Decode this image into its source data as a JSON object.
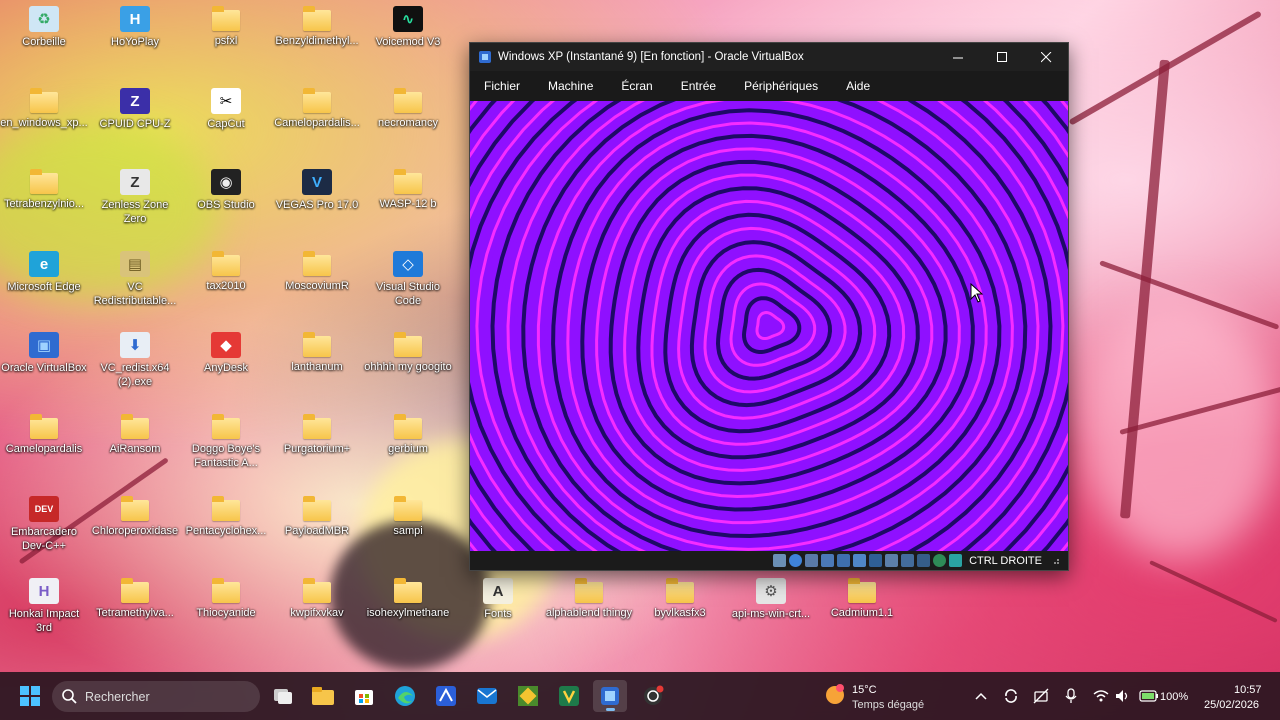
{
  "desktop": {
    "icons": [
      {
        "label": "Corbeille",
        "kind": "recycle-bin-icon"
      },
      {
        "label": "HoYoPlay",
        "kind": "hoyoplay-icon"
      },
      {
        "label": "psfxl",
        "kind": "folder-icon"
      },
      {
        "label": "Benzyldimethyl...",
        "kind": "folder-icon"
      },
      {
        "label": "Voicemod V3",
        "kind": "voicemod-icon"
      },
      {
        "label": "en_windows_xp...",
        "kind": "folder-icon"
      },
      {
        "label": "CPUID CPU-Z",
        "kind": "cpuz-icon"
      },
      {
        "label": "CapCut",
        "kind": "capcut-icon"
      },
      {
        "label": "Camelopardalis...",
        "kind": "folder-icon"
      },
      {
        "label": "necromancy",
        "kind": "folder-icon"
      },
      {
        "label": "Tetrabenzylnio...",
        "kind": "folder-icon"
      },
      {
        "label": "Zenless Zone Zero",
        "kind": "zenless-icon"
      },
      {
        "label": "OBS Studio",
        "kind": "obs-icon"
      },
      {
        "label": "VEGAS Pro 17.0",
        "kind": "vegas-icon"
      },
      {
        "label": "WASP-12 b",
        "kind": "folder-icon"
      },
      {
        "label": "Microsoft Edge",
        "kind": "edge-icon"
      },
      {
        "label": "VC Redistributable...",
        "kind": "archive-icon"
      },
      {
        "label": "tax2010",
        "kind": "folder-icon"
      },
      {
        "label": "MoscoviumR",
        "kind": "folder-icon"
      },
      {
        "label": "Visual Studio Code",
        "kind": "vscode-icon"
      },
      {
        "label": "Oracle VirtualBox",
        "kind": "virtualbox-icon"
      },
      {
        "label": "VC_redist.x64 (2).exe",
        "kind": "installer-icon"
      },
      {
        "label": "AnyDesk",
        "kind": "anydesk-icon"
      },
      {
        "label": "lanthanum",
        "kind": "folder-icon"
      },
      {
        "label": "ohhhh my googito",
        "kind": "folder-icon"
      },
      {
        "label": "Camelopardalis",
        "kind": "folder-icon"
      },
      {
        "label": "AiRansom",
        "kind": "folder-icon"
      },
      {
        "label": "Doggo Boye's Fantastic A...",
        "kind": "folder-icon"
      },
      {
        "label": "Purgatorium+",
        "kind": "folder-icon"
      },
      {
        "label": "gerbium",
        "kind": "folder-icon"
      },
      {
        "label": "Embarcadero Dev-C++",
        "kind": "devcpp-icon"
      },
      {
        "label": "Chloroperoxidase",
        "kind": "folder-icon"
      },
      {
        "label": "Pentacyclohex...",
        "kind": "folder-icon"
      },
      {
        "label": "PayloadMBR",
        "kind": "folder-icon"
      },
      {
        "label": "sampi",
        "kind": "folder-icon"
      },
      {
        "label": "Honkai Impact 3rd",
        "kind": "honkai-icon"
      },
      {
        "label": "Tetramethylva...",
        "kind": "folder-icon"
      },
      {
        "label": "Thiocyanide",
        "kind": "folder-icon"
      },
      {
        "label": "kwpifxvkav",
        "kind": "folder-icon"
      },
      {
        "label": "isohexylmethane",
        "kind": "folder-icon"
      },
      {
        "label": "Fonts",
        "kind": "fonts-icon"
      },
      {
        "label": "alphablend thingy",
        "kind": "folder-icon"
      },
      {
        "label": "byvlkasfx3",
        "kind": "folder-icon"
      },
      {
        "label": "api-ms-win-crt...",
        "kind": "dll-icon"
      },
      {
        "label": "Cadmium1.1",
        "kind": "folder-icon"
      }
    ]
  },
  "vbox": {
    "title": "Windows XP (Instantané 9) [En fonction] - Oracle VirtualBox",
    "menu": [
      "Fichier",
      "Machine",
      "Écran",
      "Entrée",
      "Périphériques",
      "Aide"
    ],
    "hostkey": "CTRL DROITE",
    "screen_colors": {
      "a": "#8f10ff",
      "b": "#1e0a66",
      "c": "#f52cff"
    }
  },
  "taskbar": {
    "search_placeholder": "Rechercher",
    "weather_temp": "15°C",
    "weather_desc": "Temps dégagé",
    "battery": "100%",
    "time": "10:57",
    "date": "25/02/2026"
  }
}
